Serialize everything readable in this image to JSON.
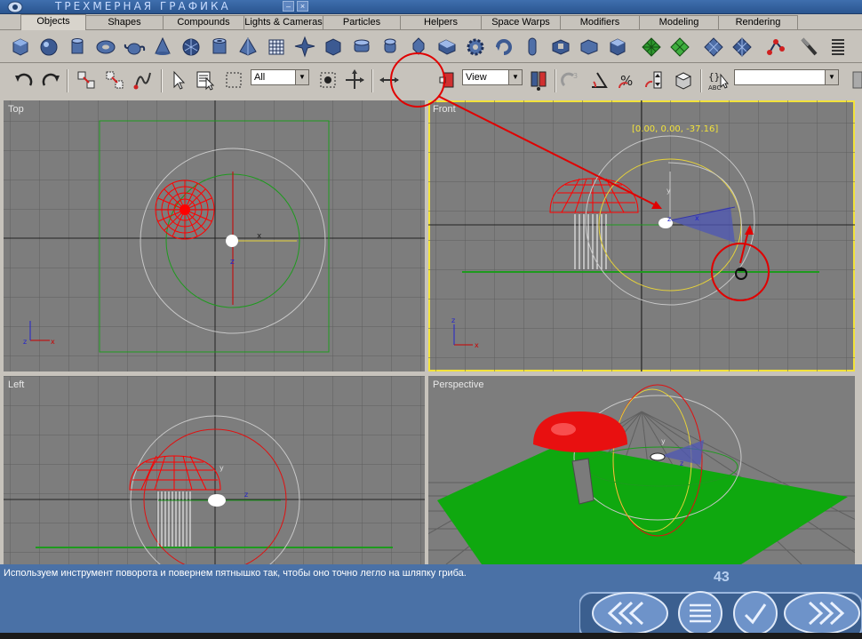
{
  "window": {
    "title": "ТРЕХМЕРНАЯ ГРАФИКА"
  },
  "tabs": [
    {
      "label": "Objects",
      "active": true
    },
    {
      "label": "Shapes"
    },
    {
      "label": "Compounds"
    },
    {
      "label": "Lights & Cameras"
    },
    {
      "label": "Particles"
    },
    {
      "label": "Helpers"
    },
    {
      "label": "Space Warps"
    },
    {
      "label": "Modifiers"
    },
    {
      "label": "Modeling"
    },
    {
      "label": "Rendering"
    }
  ],
  "toolbar": {
    "selection_filter": "All",
    "reference_coord": "View",
    "named_selection": ""
  },
  "viewports": {
    "top": {
      "label": "Top"
    },
    "front": {
      "label": "Front",
      "transform_readout": "[0.00, 0.00, -37.16]"
    },
    "left": {
      "label": "Left"
    },
    "perspective": {
      "label": "Perspective"
    }
  },
  "axes": {
    "x": "x",
    "y": "y",
    "z": "z"
  },
  "status": {
    "message": "Используем инструмент поворота и повернем пятнышко так, чтобы оно точно легло на шляпку гриба.",
    "page_number": "43"
  },
  "colors": {
    "viewport_bg": "#7d7d7d",
    "grid": "#5f5f5f",
    "active_outline": "#f2e23a",
    "annotation": "#e00000",
    "panel": "#c7c3bc",
    "status_bg": "#4a71a6"
  },
  "icons": {
    "create_box": "box-icon",
    "create_sphere": "sphere-icon",
    "create_cylinder": "cylinder-icon",
    "create_torus": "torus-icon",
    "create_teapot": "teapot-icon",
    "create_cone": "cone-icon",
    "rotate": "rotate-icon",
    "undo": "undo-icon",
    "redo": "redo-icon",
    "move": "move-icon",
    "nav_back": "double-chevron-left-icon",
    "nav_menu": "menu-icon",
    "nav_check": "check-icon",
    "nav_forward": "double-chevron-right-icon"
  }
}
